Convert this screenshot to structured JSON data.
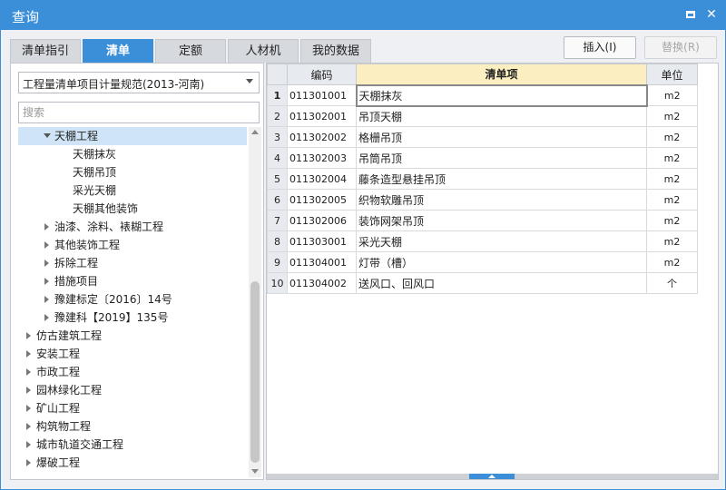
{
  "window": {
    "title": "查询"
  },
  "tabs": [
    {
      "label": "清单指引"
    },
    {
      "label": "清单"
    },
    {
      "label": "定额"
    },
    {
      "label": "人材机"
    },
    {
      "label": "我的数据"
    }
  ],
  "active_tab": "清单",
  "actions": {
    "insert": "插入(I)",
    "replace": "替换(R)"
  },
  "spec_select": {
    "value": "工程量清单项目计量规范(2013-河南)"
  },
  "search": {
    "placeholder": "搜索",
    "value": ""
  },
  "tree": {
    "nodes": [
      {
        "label": "天棚工程",
        "level": 1,
        "state": "expanded",
        "selected": true
      },
      {
        "label": "天棚抹灰",
        "level": 2,
        "state": "leaf"
      },
      {
        "label": "天棚吊顶",
        "level": 2,
        "state": "leaf"
      },
      {
        "label": "采光天棚",
        "level": 2,
        "state": "leaf"
      },
      {
        "label": "天棚其他装饰",
        "level": 2,
        "state": "leaf"
      },
      {
        "label": "油漆、涂料、裱糊工程",
        "level": 1,
        "state": "collapsed"
      },
      {
        "label": "其他装饰工程",
        "level": 1,
        "state": "collapsed"
      },
      {
        "label": "拆除工程",
        "level": 1,
        "state": "collapsed"
      },
      {
        "label": "措施项目",
        "level": 1,
        "state": "collapsed"
      },
      {
        "label": "豫建标定〔2016〕14号",
        "level": 1,
        "state": "collapsed"
      },
      {
        "label": "豫建科【2019】135号",
        "level": 1,
        "state": "collapsed"
      },
      {
        "label": "仿古建筑工程",
        "level": 0,
        "state": "collapsed"
      },
      {
        "label": "安装工程",
        "level": 0,
        "state": "collapsed"
      },
      {
        "label": "市政工程",
        "level": 0,
        "state": "collapsed"
      },
      {
        "label": "园林绿化工程",
        "level": 0,
        "state": "collapsed"
      },
      {
        "label": "矿山工程",
        "level": 0,
        "state": "collapsed"
      },
      {
        "label": "构筑物工程",
        "level": 0,
        "state": "collapsed"
      },
      {
        "label": "城市轨道交通工程",
        "level": 0,
        "state": "collapsed"
      },
      {
        "label": "爆破工程",
        "level": 0,
        "state": "collapsed"
      }
    ]
  },
  "table": {
    "headers": {
      "row_num": "",
      "code": "编码",
      "item": "清单项",
      "unit": "单位"
    },
    "current_row": 1,
    "rows": [
      {
        "num": "1",
        "code": "011301001",
        "item": "天棚抹灰",
        "unit": "m2"
      },
      {
        "num": "2",
        "code": "011302001",
        "item": "吊顶天棚",
        "unit": "m2"
      },
      {
        "num": "3",
        "code": "011302002",
        "item": "格栅吊顶",
        "unit": "m2"
      },
      {
        "num": "4",
        "code": "011302003",
        "item": "吊筒吊顶",
        "unit": "m2"
      },
      {
        "num": "5",
        "code": "011302004",
        "item": "藤条造型悬挂吊顶",
        "unit": "m2"
      },
      {
        "num": "6",
        "code": "011302005",
        "item": "织物软雕吊顶",
        "unit": "m2"
      },
      {
        "num": "7",
        "code": "011302006",
        "item": "装饰网架吊顶",
        "unit": "m2"
      },
      {
        "num": "8",
        "code": "011303001",
        "item": "采光天棚",
        "unit": "m2"
      },
      {
        "num": "9",
        "code": "011304001",
        "item": "灯带（槽）",
        "unit": "m2"
      },
      {
        "num": "10",
        "code": "011304002",
        "item": "送风口、回风口",
        "unit": "个"
      }
    ]
  },
  "icons": {
    "maximize": "maximize-icon",
    "close": "close-icon",
    "expand": "chevron-right-icon",
    "collapse": "chevron-down-icon",
    "dropdown": "chevron-down-icon"
  },
  "colors": {
    "accent": "#3b8fd9",
    "header_highlight": "#fbeec0",
    "selected_row": "#cfe5f7"
  }
}
